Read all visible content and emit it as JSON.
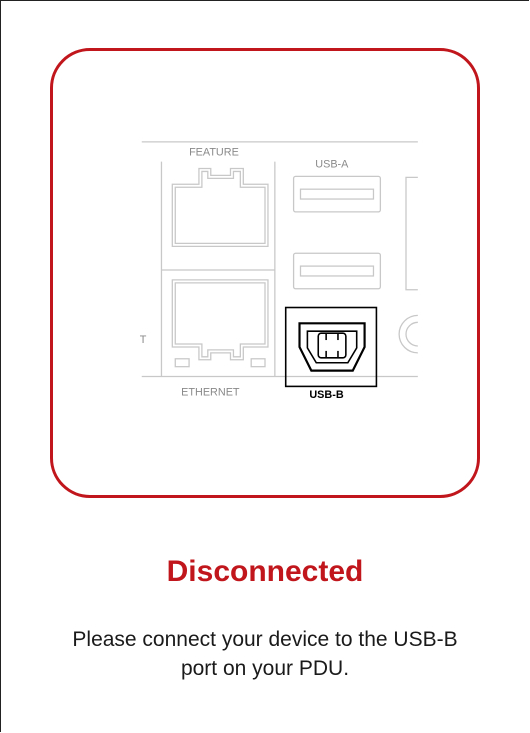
{
  "colors": {
    "accent": "#c0161c",
    "port_outline": "#c8c8c8",
    "highlight": "#000000"
  },
  "diagram": {
    "labels": {
      "feature": "FEATURE",
      "usb_a": "USB-A",
      "ethernet": "ETHERNET",
      "usb_b": "USB-B",
      "cut_text": "T"
    },
    "highlighted_port": "USB-B"
  },
  "status": {
    "title": "Disconnected"
  },
  "message": {
    "text": "Please connect your device to the USB-B port on your PDU."
  }
}
